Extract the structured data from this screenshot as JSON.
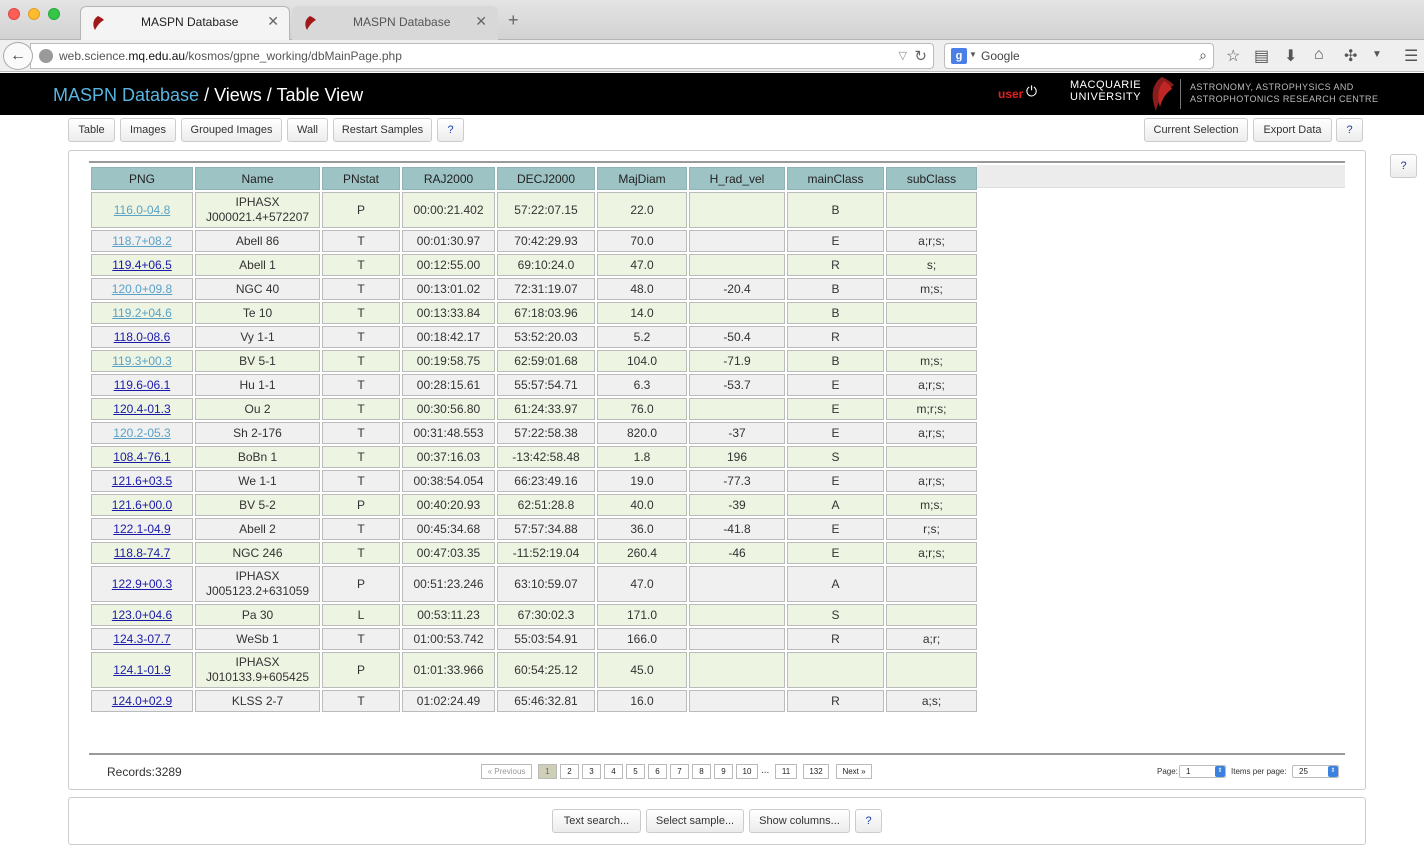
{
  "browser": {
    "tabs": [
      {
        "title": "MASPN Database",
        "active": true
      },
      {
        "title": "MASPN Database",
        "active": false
      }
    ],
    "url_prefix": "web.science.",
    "url_domain": "mq.edu.au",
    "url_path": "/kosmos/gpne_working/dbMainPage.php",
    "search_engine": "Google",
    "search_placeholder": "Google"
  },
  "header": {
    "title_db": "MASPN Database",
    "title_sep": " / ",
    "title_rest": "Views / Table View",
    "user": "user",
    "university_line1": "MACQUARIE",
    "university_line2": "UNIVERSITY",
    "dept_line1": "ASTRONOMY, ASTROPHYSICS AND",
    "dept_line2": "ASTROPHOTONICS RESEARCH CENTRE"
  },
  "toolbar": {
    "table": "Table",
    "images": "Images",
    "grouped_images": "Grouped Images",
    "wall": "Wall",
    "restart_samples": "Restart Samples",
    "help": "?",
    "current_selection": "Current Selection",
    "export_data": "Export Data"
  },
  "side_help": "?",
  "table": {
    "columns": [
      "PNG",
      "Name",
      "PNstat",
      "RAJ2000",
      "DECJ2000",
      "MajDiam",
      "H_rad_vel",
      "mainClass",
      "subClass"
    ],
    "rows": [
      {
        "png": "116.0-04.8",
        "name": "IPHASX\nJ000021.4+572207",
        "pnstat": "P",
        "ra": "00:00:21.402",
        "dec": "57:22:07.15",
        "maj": "22.0",
        "vel": "",
        "main": "B",
        "sub": "",
        "visited": true,
        "tall": true
      },
      {
        "png": "118.7+08.2",
        "name": "Abell 86",
        "pnstat": "T",
        "ra": "00:01:30.97",
        "dec": "70:42:29.93",
        "maj": "70.0",
        "vel": "",
        "main": "E",
        "sub": "a;r;s;",
        "visited": true
      },
      {
        "png": "119.4+06.5",
        "name": "Abell 1",
        "pnstat": "T",
        "ra": "00:12:55.00",
        "dec": "69:10:24.0",
        "maj": "47.0",
        "vel": "",
        "main": "R",
        "sub": "s;"
      },
      {
        "png": "120.0+09.8",
        "name": "NGC 40",
        "pnstat": "T",
        "ra": "00:13:01.02",
        "dec": "72:31:19.07",
        "maj": "48.0",
        "vel": "-20.4",
        "main": "B",
        "sub": "m;s;",
        "visited": true
      },
      {
        "png": "119.2+04.6",
        "name": "Te 10",
        "pnstat": "T",
        "ra": "00:13:33.84",
        "dec": "67:18:03.96",
        "maj": "14.0",
        "vel": "",
        "main": "B",
        "sub": "",
        "visited": true
      },
      {
        "png": "118.0-08.6",
        "name": "Vy 1-1",
        "pnstat": "T",
        "ra": "00:18:42.17",
        "dec": "53:52:20.03",
        "maj": "5.2",
        "vel": "-50.4",
        "main": "R",
        "sub": ""
      },
      {
        "png": "119.3+00.3",
        "name": "BV 5-1",
        "pnstat": "T",
        "ra": "00:19:58.75",
        "dec": "62:59:01.68",
        "maj": "104.0",
        "vel": "-71.9",
        "main": "B",
        "sub": "m;s;",
        "visited": true
      },
      {
        "png": "119.6-06.1",
        "name": "Hu 1-1",
        "pnstat": "T",
        "ra": "00:28:15.61",
        "dec": "55:57:54.71",
        "maj": "6.3",
        "vel": "-53.7",
        "main": "E",
        "sub": "a;r;s;"
      },
      {
        "png": "120.4-01.3",
        "name": "Ou 2",
        "pnstat": "T",
        "ra": "00:30:56.80",
        "dec": "61:24:33.97",
        "maj": "76.0",
        "vel": "",
        "main": "E",
        "sub": "m;r;s;"
      },
      {
        "png": "120.2-05.3",
        "name": "Sh 2-176",
        "pnstat": "T",
        "ra": "00:31:48.553",
        "dec": "57:22:58.38",
        "maj": "820.0",
        "vel": "-37",
        "main": "E",
        "sub": "a;r;s;",
        "visited": true
      },
      {
        "png": "108.4-76.1",
        "name": "BoBn 1",
        "pnstat": "T",
        "ra": "00:37:16.03",
        "dec": "-13:42:58.48",
        "maj": "1.8",
        "vel": "196",
        "main": "S",
        "sub": ""
      },
      {
        "png": "121.6+03.5",
        "name": "We 1-1",
        "pnstat": "T",
        "ra": "00:38:54.054",
        "dec": "66:23:49.16",
        "maj": "19.0",
        "vel": "-77.3",
        "main": "E",
        "sub": "a;r;s;"
      },
      {
        "png": "121.6+00.0",
        "name": "BV 5-2",
        "pnstat": "P",
        "ra": "00:40:20.93",
        "dec": "62:51:28.8",
        "maj": "40.0",
        "vel": "-39",
        "main": "A",
        "sub": "m;s;"
      },
      {
        "png": "122.1-04.9",
        "name": "Abell 2",
        "pnstat": "T",
        "ra": "00:45:34.68",
        "dec": "57:57:34.88",
        "maj": "36.0",
        "vel": "-41.8",
        "main": "E",
        "sub": "r;s;"
      },
      {
        "png": "118.8-74.7",
        "name": "NGC 246",
        "pnstat": "T",
        "ra": "00:47:03.35",
        "dec": "-11:52:19.04",
        "maj": "260.4",
        "vel": "-46",
        "main": "E",
        "sub": "a;r;s;"
      },
      {
        "png": "122.9+00.3",
        "name": "IPHASX\nJ005123.2+631059",
        "pnstat": "P",
        "ra": "00:51:23.246",
        "dec": "63:10:59.07",
        "maj": "47.0",
        "vel": "",
        "main": "A",
        "sub": "",
        "tall": true
      },
      {
        "png": "123.0+04.6",
        "name": "Pa 30",
        "pnstat": "L",
        "ra": "00:53:11.23",
        "dec": "67:30:02.3",
        "maj": "171.0",
        "vel": "",
        "main": "S",
        "sub": ""
      },
      {
        "png": "124.3-07.7",
        "name": "WeSb 1",
        "pnstat": "T",
        "ra": "01:00:53.742",
        "dec": "55:03:54.91",
        "maj": "166.0",
        "vel": "",
        "main": "R",
        "sub": "a;r;"
      },
      {
        "png": "124.1-01.9",
        "name": "IPHASX\nJ010133.9+605425",
        "pnstat": "P",
        "ra": "01:01:33.966",
        "dec": "60:54:25.12",
        "maj": "45.0",
        "vel": "",
        "main": "",
        "sub": "",
        "tall": true
      },
      {
        "png": "124.0+02.9",
        "name": "KLSS 2-7",
        "pnstat": "T",
        "ra": "01:02:24.49",
        "dec": "65:46:32.81",
        "maj": "16.0",
        "vel": "",
        "main": "R",
        "sub": "a;s;"
      }
    ]
  },
  "footer": {
    "records": "Records:3289",
    "prev": "« Previous",
    "pages": [
      "1",
      "2",
      "3",
      "4",
      "5",
      "6",
      "7",
      "8",
      "9",
      "10"
    ],
    "ellipsis": "...",
    "page_11": "11",
    "last_page": "132",
    "next": "Next »",
    "page_label": "Page:",
    "page_value": "1",
    "items_label": "Items per page:",
    "items_value": "25"
  },
  "bottom": {
    "text_search": "Text search...",
    "select_sample": "Select sample...",
    "show_columns": "Show columns...",
    "help": "?"
  }
}
